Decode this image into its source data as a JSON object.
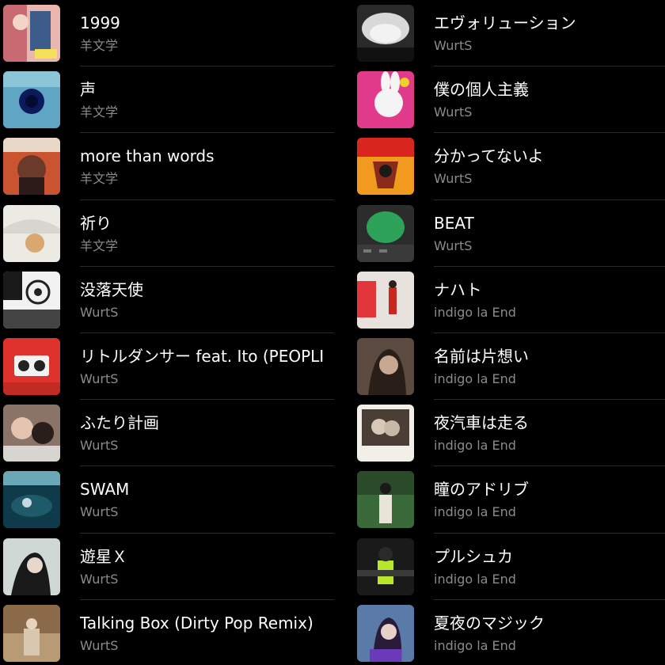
{
  "left_column": [
    {
      "title": "1999",
      "artist": "羊文学",
      "art_icon": "album-art-1999"
    },
    {
      "title": "声",
      "artist": "羊文学",
      "art_icon": "album-art-koe"
    },
    {
      "title": "more than words",
      "artist": "羊文学",
      "art_icon": "album-art-more-than-words"
    },
    {
      "title": "祈り",
      "artist": "羊文学",
      "art_icon": "album-art-inori"
    },
    {
      "title": "没落天使",
      "artist": "WurtS",
      "art_icon": "album-art-botsuraku-tenshi"
    },
    {
      "title": "リトルダンサー feat. Ito (PEOPLI",
      "artist": "WurtS",
      "art_icon": "album-art-little-dancer"
    },
    {
      "title": "ふたり計画",
      "artist": "WurtS",
      "art_icon": "album-art-futari-keikaku"
    },
    {
      "title": "SWAM",
      "artist": "WurtS",
      "art_icon": "album-art-swam"
    },
    {
      "title": "遊星Ｘ",
      "artist": "WurtS",
      "art_icon": "album-art-yusei-x"
    },
    {
      "title": "Talking Box (Dirty Pop Remix)",
      "artist": "WurtS",
      "art_icon": "album-art-talking-box"
    }
  ],
  "right_column": [
    {
      "title": "エヴォリューション",
      "artist": "WurtS",
      "art_icon": "album-art-evolution"
    },
    {
      "title": "僕の個人主義",
      "artist": "WurtS",
      "art_icon": "album-art-boku-no-kojinshugi"
    },
    {
      "title": "分かってないよ",
      "artist": "WurtS",
      "art_icon": "album-art-wakattenaiyo"
    },
    {
      "title": "BEAT",
      "artist": "WurtS",
      "art_icon": "album-art-beat"
    },
    {
      "title": "ナハト",
      "artist": "indigo la End",
      "art_icon": "album-art-nacht"
    },
    {
      "title": "名前は片想い",
      "artist": "indigo la End",
      "art_icon": "album-art-namae-wa-kataomoi"
    },
    {
      "title": "夜汽車は走る",
      "artist": "indigo la End",
      "art_icon": "album-art-yogisha"
    },
    {
      "title": "瞳のアドリブ",
      "artist": "indigo la End",
      "art_icon": "album-art-hitomi-no-adlib"
    },
    {
      "title": "プルシュカ",
      "artist": "indigo la End",
      "art_icon": "album-art-prushka"
    },
    {
      "title": "夏夜のマジック",
      "artist": "indigo la End",
      "art_icon": "album-art-natsuyo-no-magic"
    }
  ],
  "colors": {
    "background": "#000000",
    "title_text": "#ffffff",
    "artist_text": "#8b8b8e",
    "separator": "#2a2a2c"
  }
}
